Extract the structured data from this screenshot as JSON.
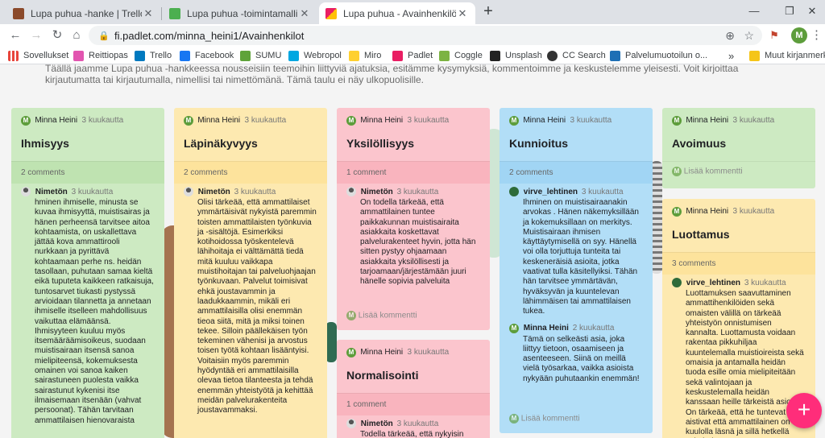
{
  "browser": {
    "tabs": [
      {
        "title": "Lupa puhua -hanke | Trello",
        "color": "#8b4a2b"
      },
      {
        "title": "Lupa puhua -toimintamallin tai v",
        "color": "#4caf50"
      },
      {
        "title": "Lupa puhua - Avainhenkilöt",
        "color": "#e91e63"
      }
    ],
    "new_tab": "+",
    "url": "fi.padlet.com/minna_heini1/Avainhenkilot",
    "bookmarks": [
      {
        "label": "Sovellukset",
        "color": "#e8453c"
      },
      {
        "label": "Reittiopas",
        "color": "#e255b0"
      },
      {
        "label": "Trello",
        "color": "#0079bf"
      },
      {
        "label": "Facebook",
        "color": "#1877f2"
      },
      {
        "label": "SUMU",
        "color": "#5fa33a"
      },
      {
        "label": "Webropol",
        "color": "#00a7e1"
      },
      {
        "label": "Miro",
        "color": "#ffd02f"
      },
      {
        "label": "Padlet",
        "color": "#e91e63"
      },
      {
        "label": "Coggle",
        "color": "#7cb342"
      },
      {
        "label": "Unsplash",
        "color": "#222222"
      },
      {
        "label": "CC Search",
        "color": "#333333"
      },
      {
        "label": "Palvelumuotoilun o...",
        "color": "#1e6fb5"
      }
    ],
    "more": "»",
    "other_bookmarks": "Muut kirjanmerkit",
    "profile_initial": "M"
  },
  "padlet": {
    "description": "Täällä jaamme Lupa puhua -hankkeessa nousseisiin teemoihin liittyviä ajatuksia, esitämme kysymyksiä, kommentoimme ja keskustelemme yleisesti. Voit kirjoittaa kirjautumatta tai kirjautumalla, nimellisi tai nimettömänä. Tämä taulu ei näy ulkopuolisille.",
    "avatar_initial": "M",
    "add_comment": "Lisää kommentti",
    "fab": "+",
    "cards": {
      "ihmisyys": {
        "author": "Minna Heini",
        "time": "3 kuukautta",
        "title": "Ihmisyys",
        "count": "2 comments",
        "comments": [
          {
            "author": "Nimetön",
            "time": "3 kuukautta",
            "text": "hminen ihmiselle, minusta se kuvaa ihmisyyttä, muistisairas ja hänen perheensä tarvitsee aitoa kohtaamista, on uskallettava jättää kova ammattirooli nurkkaan ja pyrittävä kohtaamaan perhe ns. heidän tasollaan, puhutaan samaa kieltä eikä tuputeta kaikkeen ratkaisuja, tuntosarvet tiukasti pystyssä arvioidaan tilannetta ja annetaan ihmiselle itselleen mahdollisuus vaikuttaa elämäänsä. Ihmisyyteen kuuluu myös itsemääräämisoikeus, suodaan muistisairaan itsensä sanoa mielipiteensä, kokemuksesta omainen voi sanoa kaiken sairastuneen puolesta vaikka sairastunut kykenisi itse ilmaisemaan itsenään (vahvat persoonat). Tähän tarvitaan ammattilaisen hienovaraista"
          }
        ]
      },
      "lapinakyvyys": {
        "author": "Minna Heini",
        "time": "3 kuukautta",
        "title": "Läpinäkyvyys",
        "count": "2 comments",
        "comments": [
          {
            "author": "Nimetön",
            "time": "3 kuukautta",
            "text": "Olisi tärkeää, että ammattilaiset ymmärtäisivät nykyistä paremmin toisten ammattilaisten työnkuvia ja -sisältöjä. Esimerkiksi kotihoidossa työskentelevä lähihoitaja ei välttämättä tiedä mitä kuuluu vaikkapa muistihoitajan tai palveluohjaajan työnkuvaan. Palvelut toimisivat ehkä joustavammin ja laadukkaammin, mikäli eri ammattilaisilla olisi enemmän tieoa siitä, mitä ja miksi toinen tekee. Silloin päällekäisen työn tekeminen vähenisi ja arvostus toisen työtä kohtaan lisääntyisi. Voitaisiin myös paremmin hyödyntää eri ammattilaisilla olevaa tietoa tilanteesta ja tehdä enemmän yhteistyötä ja kehittää meidän palvelurakenteita joustavammaksi."
          }
        ]
      },
      "yksilollisyys": {
        "author": "Minna Heini",
        "time": "3 kuukautta",
        "title": "Yksilöllisyys",
        "count": "1 comment",
        "comments": [
          {
            "author": "Nimetön",
            "time": "3 kuukautta",
            "text": "On todella tärkeää, että ammattilainen tuntee paikkakunnan muistisairaita asiakkaita koskettavat palvelurakenteet hyvin, jotta hän sitten pystyy ohjaamaan asiakkaita yksilöllisesti ja tarjoamaan/järjestämään juuri hänelle sopivia palveluita"
          }
        ]
      },
      "normalisointi": {
        "author": "Minna Heini",
        "time": "3 kuukautta",
        "title": "Normalisointi",
        "count": "1 comment",
        "comments": [
          {
            "author": "Nimetön",
            "time": "3 kuukautta",
            "text": "Todella tärkeää, että nykyisin"
          }
        ]
      },
      "kunnioitus": {
        "author": "Minna Heini",
        "time": "3 kuukautta",
        "title": "Kunnioitus",
        "count": "2 comments",
        "comments": [
          {
            "author": "virve_lehtinen",
            "time": "3 kuukautta",
            "text": "Ihminen on muistisairaanakin arvokas . Hänen näkemyksillään ja kokemuksillaan on merkitys. Muistisairaan ihmisen käyttäytymisellä on syy. Hänellä voi olla torjuttuja tunteita tai keskeneräisiä asioita, jotka vaativat tulla käsitellyiksi. Tähän hän tarvitsee ymmärtävän, hyväksyvän ja kuuntelevan lähimmäisen tai ammattilaisen tukea."
          },
          {
            "author": "Minna Heini",
            "time": "2 kuukautta",
            "text": "Tämä on selkeästi asia, joka liittyy tietoon, osaamiseen ja asenteeseen. Siinä on meillä vielä työsarkaa, vaikka asioista nykyään puhutaankin enemmän!"
          }
        ]
      },
      "avoimuus": {
        "author": "Minna Heini",
        "time": "3 kuukautta",
        "title": "Avoimuus"
      },
      "luottamus": {
        "author": "Minna Heini",
        "time": "3 kuukautta",
        "title": "Luottamus",
        "count": "3 comments",
        "comments": [
          {
            "author": "virve_lehtinen",
            "time": "3 kuukautta",
            "text": "Luottamuksen saavuttaminen ammattihenkilöiden sekä omaisten välillä on tärkeää yhteistyön onnistumisen kannalta. Luottamusta voidaan rakentaa pikkuhiljaa kuuntelemalla muistioireista sekä omaisia ja antamalla heidän tuoda esille omia mielipiteitään sekä valintojaan ja keskustelemalla heidän kanssaan heille tärkeistä asioista. On tärkeää, että he tuntevat ja aistivat että ammattilainen on kuulolla läsnä ja sillä hetkellä vain heitä"
          }
        ]
      }
    }
  }
}
